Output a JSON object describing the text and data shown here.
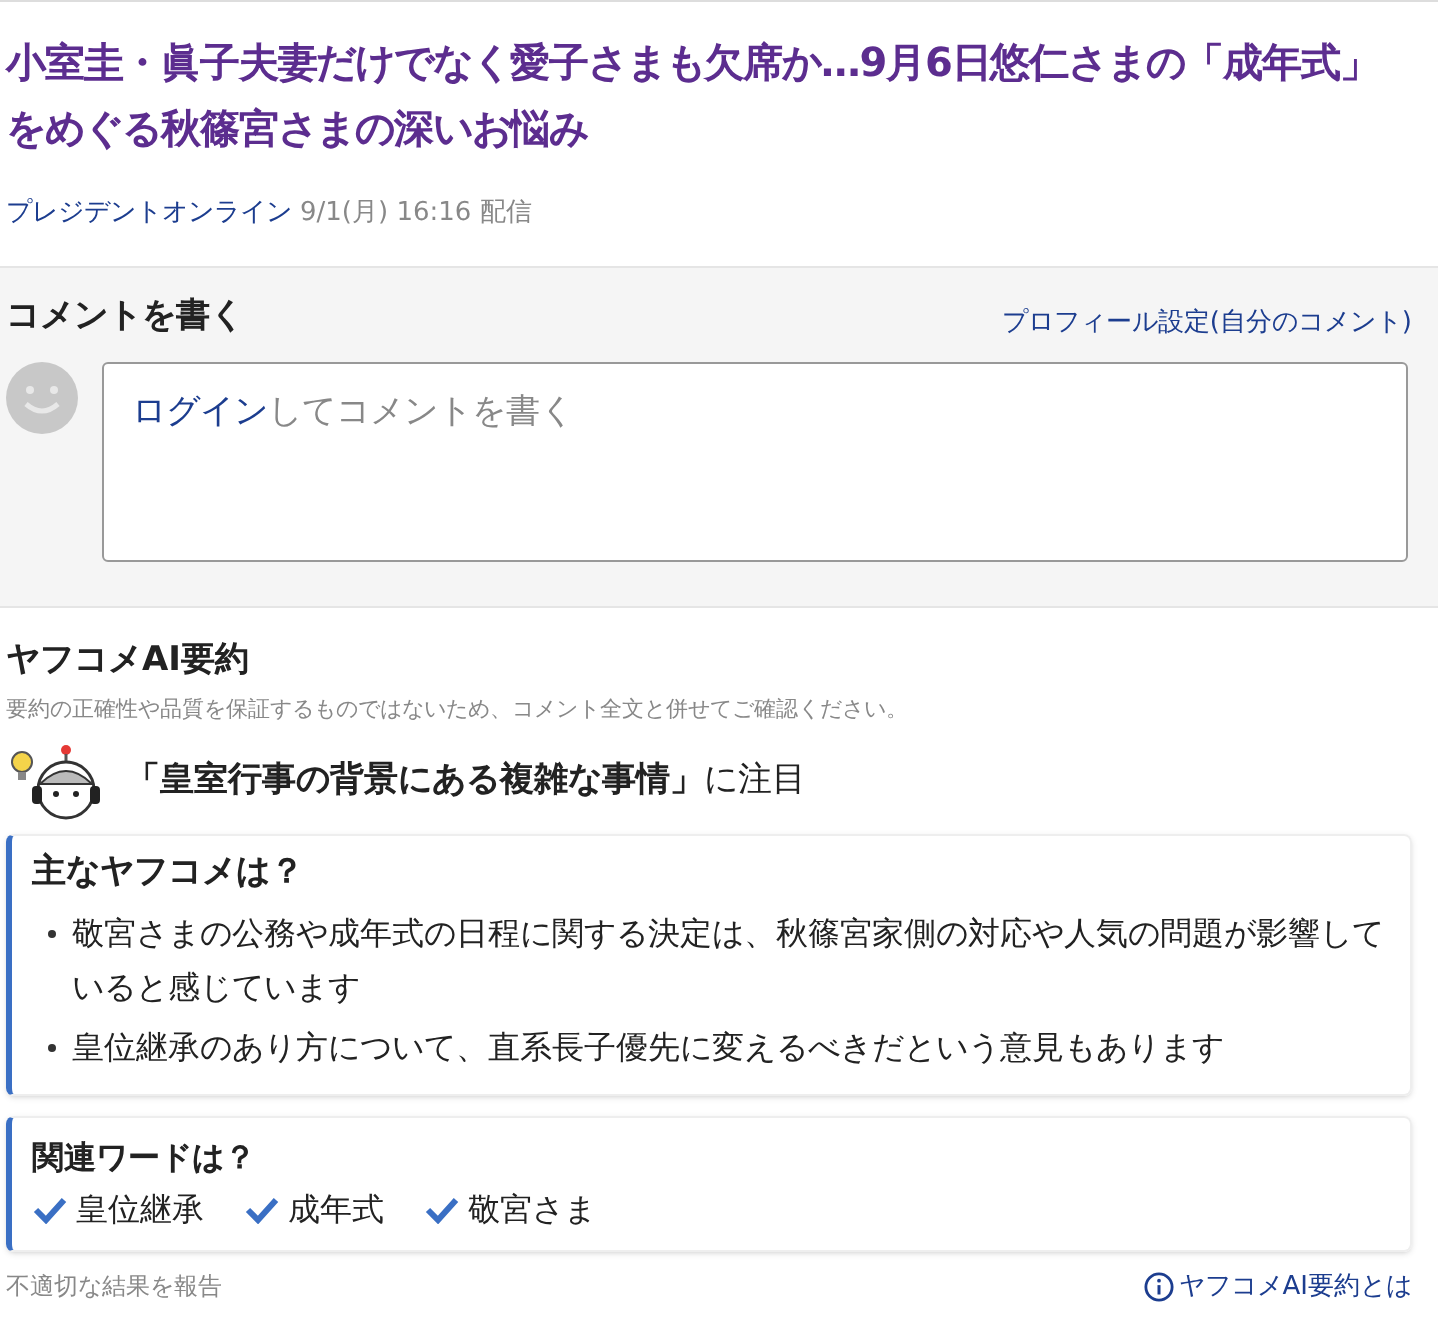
{
  "article": {
    "title": "小室圭・眞子夫妻だけでなく愛子さまも欠席か…9月6日悠仁さまの「成年式」をめぐる秋篠宮さまの深いお悩み",
    "source": "プレジデントオンライン",
    "date": "9/1(月) 16:16 配信"
  },
  "comment_form": {
    "heading": "コメントを書く",
    "profile_link": "プロフィール設定(自分のコメント)",
    "login_link": "ログイン",
    "prompt": "してコメントを書く"
  },
  "ai_summary": {
    "heading": "ヤフコメAI要約",
    "disclaimer": "要約の正確性や品質を保証するものではないため、コメント全文と併せてご確認ください。",
    "focus": "**「皇室行事の背景にある複雑な事情」**に注目",
    "main_box": {
      "heading": "主なヤフコメは？",
      "bullets": [
        "敬宮さまの公務や成年式の日程に関する決定は、秋篠宮家側の対応や人気の問題が影響していると感じています",
        "皇位継承のあり方について、直系長子優先に変えるべきだという意見もあります"
      ]
    },
    "keywords_box": {
      "heading": "関連ワードは？",
      "keywords": [
        "皇位継承",
        "成年式",
        "敬宮さま"
      ]
    },
    "report_link": "不適切な結果を報告",
    "about_link": "ヤフコメAI要約とは"
  }
}
